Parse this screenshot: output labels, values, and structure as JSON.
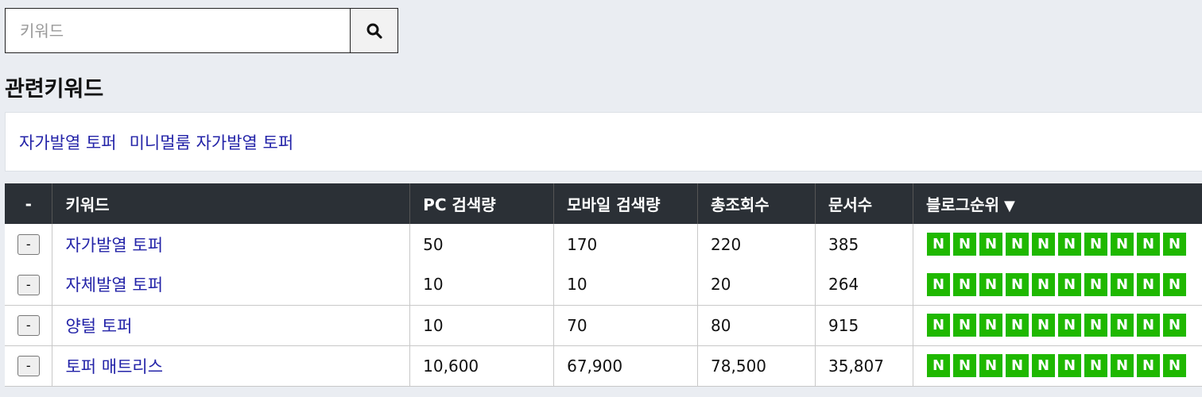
{
  "search": {
    "placeholder": "키워드"
  },
  "related": {
    "title": "관련키워드",
    "items": [
      "자가발열 토퍼",
      "미니멀룸 자가발열 토퍼"
    ]
  },
  "table": {
    "headers": [
      "-",
      "키워드",
      "PC 검색량",
      "모바일 검색량",
      "총조회수",
      "문서수",
      "블로그순위"
    ],
    "sort_indicator": "▼",
    "rows": [
      {
        "btn": "-",
        "keyword": "자가발열 토퍼",
        "pc": "50",
        "mobile": "170",
        "total": "220",
        "docs": "385"
      },
      {
        "btn": "-",
        "keyword": "자체발열 토퍼",
        "pc": "10",
        "mobile": "10",
        "total": "20",
        "docs": "264"
      },
      {
        "btn": "-",
        "keyword": "양털 토퍼",
        "pc": "10",
        "mobile": "70",
        "total": "80",
        "docs": "915"
      },
      {
        "btn": "-",
        "keyword": "토퍼 매트리스",
        "pc": "10,600",
        "mobile": "67,900",
        "total": "78,500",
        "docs": "35,807"
      }
    ],
    "rank_badge": "N",
    "rank_badge_count": 10
  },
  "colors": {
    "header_bg": "#2b3036",
    "badge_green": "#1fb800",
    "link": "#2323a8"
  },
  "icons": {
    "search_button": "search-icon"
  }
}
